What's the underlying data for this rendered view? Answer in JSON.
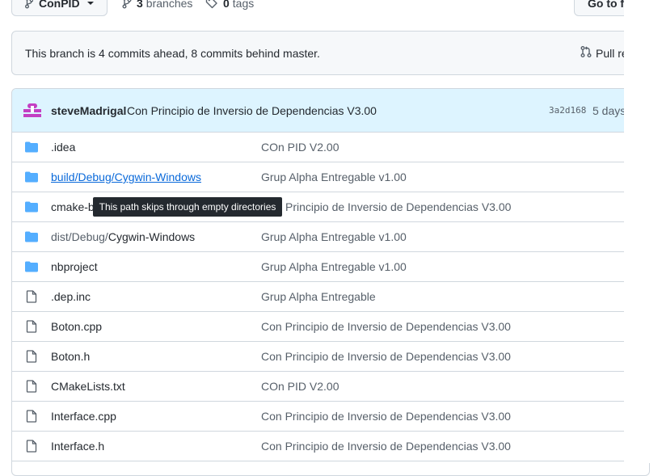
{
  "topbar": {
    "branch_label": "ConPID",
    "branches_count": "3",
    "branches_label": "branches",
    "tags_count": "0",
    "tags_label": "tags",
    "goto_label": "Go to f"
  },
  "branch_info": {
    "text": "This branch is 4 commits ahead, 8 commits behind master.",
    "pull_label": "Pull re"
  },
  "latest_commit": {
    "author": "steveMadrigal",
    "message": "Con Principio de Inversio de Dependencias V3.00",
    "sha": "3a2d168",
    "age": "5 days"
  },
  "files": [
    {
      "type": "folder",
      "name": ".idea",
      "commit": "COn PID V2.00"
    },
    {
      "type": "folder",
      "name": "build/Debug/Cygwin-Windows",
      "commit": "Grup Alpha Entregable v1.00"
    },
    {
      "type": "folder",
      "name": "cmake-b",
      "commit": "Principio de Inversio de Dependencias V3.00"
    },
    {
      "type": "folder",
      "name_dim": "dist/Debug/",
      "name_rest": "Cygwin-Windows",
      "commit": "Grup Alpha Entregable v1.00"
    },
    {
      "type": "folder",
      "name": "nbproject",
      "commit": "Grup Alpha Entregable v1.00"
    },
    {
      "type": "file",
      "name": ".dep.inc",
      "commit": "Grup Alpha Entregable"
    },
    {
      "type": "file",
      "name": "Boton.cpp",
      "commit": "Con Principio de Inversio de Dependencias V3.00"
    },
    {
      "type": "file",
      "name": "Boton.h",
      "commit": "Con Principio de Inversio de Dependencias V3.00"
    },
    {
      "type": "file",
      "name": "CMakeLists.txt",
      "commit": "COn PID V2.00"
    },
    {
      "type": "file",
      "name": "Interface.cpp",
      "commit": "Con Principio de Inversio de Dependencias V3.00"
    },
    {
      "type": "file",
      "name": "Interface.h",
      "commit": "Con Principio de Inversio de Dependencias V3.00"
    }
  ],
  "tooltip": {
    "text": "This path skips through empty directories"
  },
  "colors": {
    "folder": "#54aeff",
    "link": "#0969da",
    "commit_bg": "#ddf4ff",
    "avatar": "#c33fc3"
  }
}
